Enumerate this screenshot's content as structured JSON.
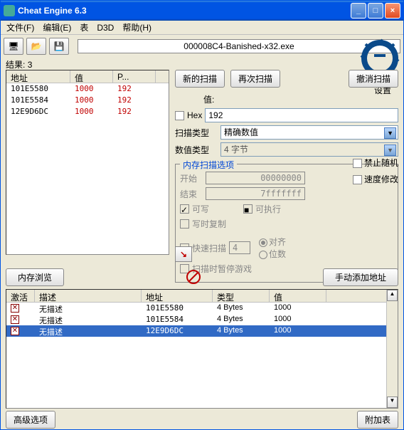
{
  "window": {
    "title": "Cheat Engine 6.3"
  },
  "menu": {
    "file": "文件(F)",
    "edit": "编辑(E)",
    "table": "表",
    "d3d": "D3D",
    "help": "帮助(H)"
  },
  "process": {
    "name": "000008C4-Banished-x32.exe"
  },
  "settings_label": "设置",
  "results_label": "结果:",
  "results_count": "3",
  "left": {
    "headers": {
      "addr": "地址",
      "val": "值",
      "prev": "P..."
    },
    "rows": [
      {
        "addr": "101E5580",
        "val": "1000",
        "prev": "192"
      },
      {
        "addr": "101E5584",
        "val": "1000",
        "prev": "192"
      },
      {
        "addr": "12E9D6DC",
        "val": "1000",
        "prev": "192"
      }
    ]
  },
  "scan": {
    "new": "新的扫描",
    "next": "再次扫描",
    "undo": "撤消扫描",
    "value_label": "值:",
    "hex_label": "Hex",
    "value": "192",
    "scantype_label": "扫描类型",
    "scantype": "精确数值",
    "valuetype_label": "数值类型",
    "valuetype": "4 字节"
  },
  "memscan": {
    "title": "内存扫描选项",
    "start_label": "开始",
    "start": "00000000",
    "stop_label": "结束",
    "stop": "7fffffff",
    "writable": "可写",
    "executable": "可执行",
    "cow": "写时复制",
    "fastscan": "快速扫描",
    "fastscan_val": "4",
    "align": "对齐",
    "digits": "位数",
    "pause": "扫描时暂停游戏"
  },
  "sideopts": {
    "norand": "禁止随机",
    "speedhack": "速度修改"
  },
  "midbar": {
    "memview": "内存浏览",
    "addmanual": "手动添加地址"
  },
  "bottom": {
    "headers": {
      "active": "激活",
      "desc": "描述",
      "addr": "地址",
      "type": "类型",
      "val": "值"
    },
    "rows": [
      {
        "desc": "无描述",
        "addr": "101E5580",
        "type": "4 Bytes",
        "val": "1000",
        "selected": false
      },
      {
        "desc": "无描述",
        "addr": "101E5584",
        "type": "4 Bytes",
        "val": "1000",
        "selected": false
      },
      {
        "desc": "无描述",
        "addr": "12E9D6DC",
        "type": "4 Bytes",
        "val": "1000",
        "selected": true
      }
    ]
  },
  "bottombar": {
    "advanced": "高级选项",
    "tableextra": "附加表"
  }
}
